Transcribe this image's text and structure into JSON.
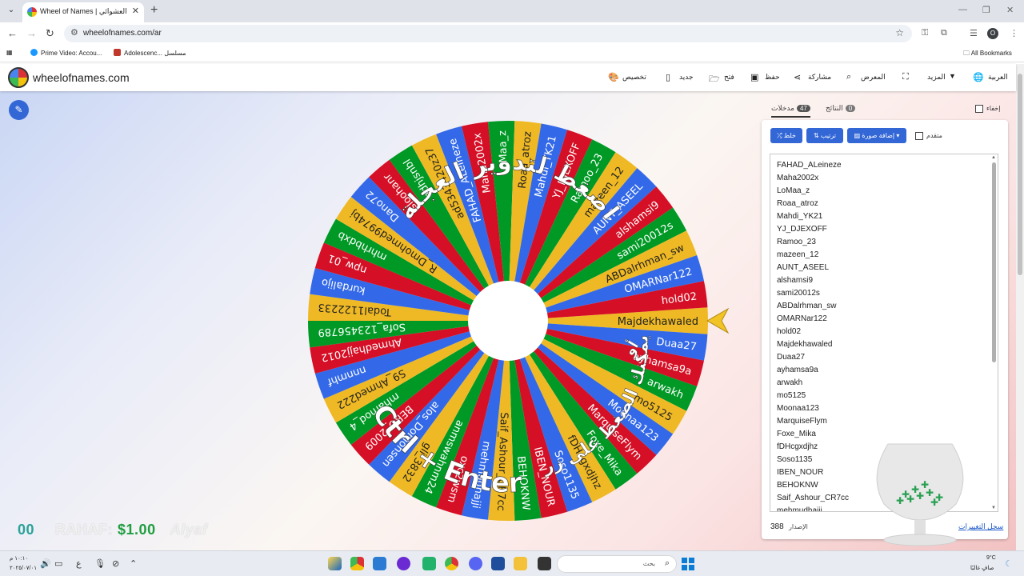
{
  "browser": {
    "tab_title": "Wheel of Names | اسم العشوائي",
    "url": "wheelofnames.com/ar",
    "bookmarks": [
      "Prime Video: Accou...",
      "Adolescenc... مسلسل"
    ],
    "all_bookmarks": "All Bookmarks",
    "profile_initial": "O"
  },
  "header": {
    "brand": "wheelofnames.com",
    "nav": {
      "customize": "تخصيص",
      "new": "جديد",
      "open": "فتح",
      "save": "حفظ",
      "share": "مشاركة",
      "gallery": "المعرض",
      "more": "المزيد",
      "language": "العربية"
    }
  },
  "wheel": {
    "slices": [
      "Majdekhawaled",
      "Duaa27",
      "ayhamsa9a",
      "arwakh",
      "mo5125",
      "Moonaa123",
      "MarquiseFlym",
      "Foxe_Mika",
      "fDHcgxdjhz",
      "Soso1135",
      "IBEN_NOUR",
      "BEHOKNW",
      "Saif_Ashour_CR7cc",
      "mehmudhajji",
      "oxc2wsm",
      "anmswahnm24",
      "gli_3832",
      "alos_Domohsen",
      "BERO_2009",
      "mhamod_4",
      "S9_Ahmed222",
      "nnnmhf",
      "Ahmedhajj2012",
      "Sofa_123456789",
      "Todal1122233",
      "kurdalijo",
      "npw_01",
      "mhrhbdxb",
      "R_Dmohmed9974bj",
      "Dano72",
      "sloohanr",
      "adhjsnbl",
      "ad5343420z37",
      "FAHAD_ALeineze",
      "Maha2002x",
      "LoMaa_z",
      "Roaa_atroz",
      "Mahdi_YK21",
      "YJ_DJEXOFF",
      "Ramoo_23",
      "mazeen_12",
      "AUNT_ASEEL",
      "alshamsi9",
      "sami20012s",
      "ABDalrhman_sw",
      "OMARNar122",
      "hold02"
    ],
    "colors": [
      "#efb925",
      "#3369e8",
      "#d50f25",
      "#009925"
    ],
    "overlay_top": "اضغط لتدوير العجلة",
    "overlay_bottom_small": "أو",
    "overlay_bottom_1": "يمكنك الضغط على زر",
    "overlay_bottom_2": "Ctrl + Enter"
  },
  "ticker": {
    "part1": "00",
    "part2": "RAHAF:",
    "part3": "$1.00",
    "part4": "Alyaf"
  },
  "panel": {
    "hide_label": "إخفاء",
    "tab_entries": "مدخلات",
    "entries_count": "47",
    "tab_results": "النتائج",
    "results_count": "0",
    "btn_shuffle": "خلط",
    "btn_sort": "ترتيب",
    "btn_add_image": "إضافة صورة",
    "advanced_label": "متقدم",
    "entries_visible": [
      "FAHAD_ALeineze",
      "Maha2002x",
      "LoMaa_z",
      "Roaa_atroz",
      "Mahdi_YK21",
      "YJ_DJEXOFF",
      "Ramoo_23",
      "mazeen_12",
      "AUNT_ASEEL",
      "alshamsi9",
      "sami20012s",
      "ABDalrhman_sw",
      "OMARNar122",
      "hold02",
      "Majdekhawaled",
      "Duaa27",
      "ayhamsa9a",
      "arwakh",
      "mo5125",
      "Moonaa123",
      "MarquiseFlym",
      "Foxe_Mika",
      "fDHcgxdjhz",
      "Soso1135",
      "IBEN_NOUR",
      "BEHOKNW",
      "Saif_Ashour_CR7cc",
      "mehmudhajji"
    ],
    "version_label": "الإصدار",
    "version_number": "388",
    "changelog": "سجل التغييرات"
  },
  "taskbar": {
    "time": "١٠:١٠ م",
    "date": "٢٠٢٥/٠٧/٠١",
    "search_placeholder": "بحث",
    "weather_temp": "9°C",
    "weather_desc": "صافٍ غالبًا",
    "lang": "ع"
  }
}
